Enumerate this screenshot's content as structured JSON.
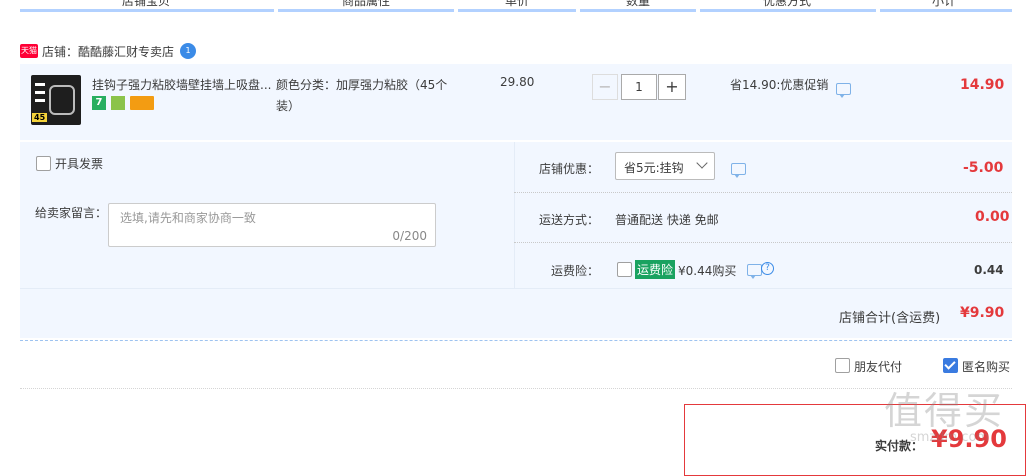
{
  "table_header": {
    "cols": [
      "店铺宝贝",
      "商品属性",
      "单价",
      "数量",
      "优惠方式",
      "小计"
    ]
  },
  "shop": {
    "badge": "天猫",
    "label": "店铺：",
    "name": "酷酷藤汇财专卖店",
    "chat_badge": "1"
  },
  "item": {
    "title": "挂钩子强力粘胶墙壁挂墙上吸盘...",
    "thumb_badge": "45",
    "attr_label": "颜色分类：",
    "attr_value_line1": "加厚强力粘胶（45个",
    "attr_value_line2": "装）",
    "unit_price": "29.80",
    "quantity": "1",
    "minus": "−",
    "plus": "+",
    "promo": "省14.90:优惠促销",
    "subtotal": "14.90",
    "tag_seven": "7"
  },
  "invoice": {
    "label": "开具发票"
  },
  "message": {
    "label": "给卖家留言：",
    "placeholder": "选填,请先和商家协商一致",
    "counter": "0/200"
  },
  "shop_discount": {
    "label": "店铺优惠：",
    "selected": "省5元:挂钩",
    "amount": "-5.00"
  },
  "shipping": {
    "label": "运送方式：",
    "value": "普通配送 快递 免邮",
    "amount": "0.00"
  },
  "insurance": {
    "label": "运费险：",
    "tag": "运费险",
    "text": "¥0.44购买",
    "help": "?",
    "amount": "0.44"
  },
  "shop_total": {
    "label": "店铺合计(含运费)",
    "amount": "¥9.90"
  },
  "options": {
    "friend_pay": "朋友代付",
    "anonymous": "匿名购买"
  },
  "payment": {
    "label": "实付款：",
    "amount": "¥9.90"
  },
  "watermark": {
    "chars": "值得买",
    "domain": "smzdm.com"
  },
  "colors": {
    "accent_blue": "#3a7be0",
    "price_red": "#e4393c",
    "row_bg": "#f2f7ff"
  }
}
